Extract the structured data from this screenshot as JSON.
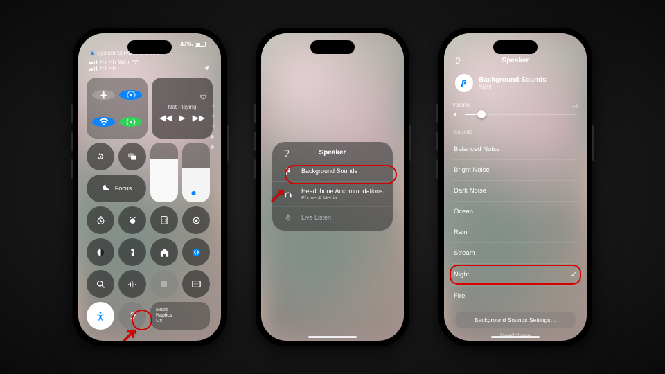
{
  "status": {
    "battery_pct": "47%",
    "services_tag": "System Services & LAGO"
  },
  "network": {
    "wifi": "HT HR WiFi",
    "cell": "HT HR"
  },
  "media": {
    "not_playing": "Not Playing"
  },
  "focus": {
    "label": "Focus"
  },
  "music_haptics": {
    "line1": "Music",
    "line2": "Haptics",
    "line3": "Off"
  },
  "hearing": {
    "title": "Speaker",
    "bg_sounds": "Background Sounds",
    "headphone": "Headphone Accommodations",
    "headphone_sub": "Phone & Media",
    "live_listen": "Live Listen"
  },
  "p3": {
    "title": "Speaker",
    "bg_label": "Background Sounds",
    "bg_current": "Night",
    "volume_label": "Volume",
    "volume_value": "15",
    "sounds_header": "Sounds",
    "options": [
      "Balanced Noise",
      "Bright Noise",
      "Dark Noise",
      "Ocean",
      "Rain",
      "Stream",
      "Night",
      "Fire"
    ],
    "selected": "Night",
    "settings_btn": "Background Sounds Settings…",
    "cutoff": "Headphone"
  }
}
